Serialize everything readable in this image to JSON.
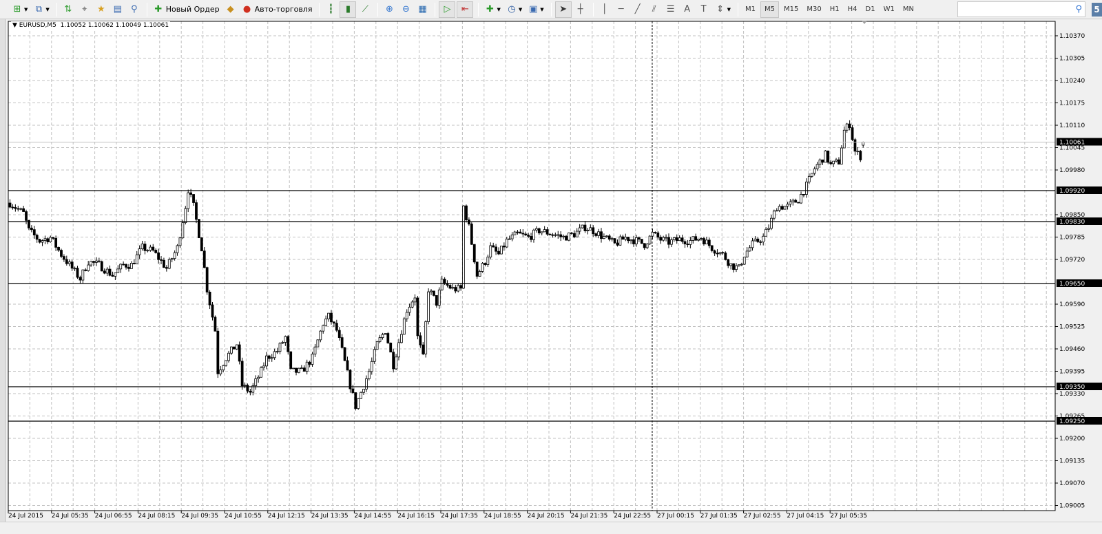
{
  "toolbar": {
    "items": [
      {
        "name": "new-chart",
        "icon": "new-chart-icon",
        "dropdown": true
      },
      {
        "name": "profiles",
        "icon": "profiles-icon",
        "dropdown": true
      },
      {
        "sep": true
      },
      {
        "name": "market-watch",
        "icon": "market-watch-icon"
      },
      {
        "name": "data-window",
        "icon": "crosshair-icon"
      },
      {
        "name": "navigator",
        "icon": "navigator-icon"
      },
      {
        "name": "terminal",
        "icon": "terminal-icon"
      },
      {
        "name": "strategy-tester",
        "icon": "tester-icon"
      },
      {
        "sep": true
      },
      {
        "name": "new-order",
        "icon": "new-order-icon",
        "label": "Новый Ордер"
      },
      {
        "name": "metaeditor",
        "icon": "metaeditor-icon"
      },
      {
        "name": "auto-trading",
        "icon": "auto-trading-icon",
        "label": "Авто-торговля"
      },
      {
        "sep": true
      },
      {
        "name": "bar-chart",
        "icon": "bar-chart-icon"
      },
      {
        "name": "candlesticks",
        "icon": "candlestick-icon",
        "active": true
      },
      {
        "name": "line-chart",
        "icon": "line-chart-icon"
      },
      {
        "sep": true
      },
      {
        "name": "zoom-in",
        "icon": "zoom-in-icon"
      },
      {
        "name": "zoom-out",
        "icon": "zoom-out-icon"
      },
      {
        "name": "tile-windows",
        "icon": "tile-icon"
      },
      {
        "sep": true
      },
      {
        "name": "auto-scroll",
        "icon": "auto-scroll-icon",
        "active": true
      },
      {
        "name": "chart-shift",
        "icon": "chart-shift-icon",
        "active": true
      },
      {
        "sep": true
      },
      {
        "name": "indicators",
        "icon": "indicators-icon",
        "dropdown": true
      },
      {
        "name": "periods",
        "icon": "clock-icon",
        "dropdown": true
      },
      {
        "name": "templates",
        "icon": "templates-icon",
        "dropdown": true
      },
      {
        "sep": true
      },
      {
        "name": "cursor",
        "icon": "cursor-icon",
        "active": true
      },
      {
        "name": "crosshair",
        "icon": "crosshair-tool-icon"
      },
      {
        "sep": true
      },
      {
        "name": "vertical-line",
        "icon": "vertical-line-icon"
      },
      {
        "name": "horizontal-line",
        "icon": "horizontal-line-icon"
      },
      {
        "name": "trendline",
        "icon": "trendline-icon"
      },
      {
        "name": "equidistant-channel",
        "icon": "channel-icon"
      },
      {
        "name": "fibonacci",
        "icon": "fibonacci-icon"
      },
      {
        "name": "text",
        "icon": "text-icon"
      },
      {
        "name": "text-label",
        "icon": "text-label-icon"
      },
      {
        "name": "arrows",
        "icon": "arrows-icon",
        "dropdown": true
      },
      {
        "sep": true
      }
    ],
    "timeframes": [
      "M1",
      "M5",
      "M15",
      "M30",
      "H1",
      "H4",
      "D1",
      "W1",
      "MN"
    ],
    "active_timeframe": "M5",
    "search_placeholder": "",
    "badge": "5"
  },
  "chart_data": {
    "type": "candlestick",
    "title": "EURUSD,M5  1.10052 1.10062 1.10049 1.10061",
    "symbol": "EURUSD",
    "timeframe": "M5",
    "ohlc_last": {
      "open": 1.10052,
      "high": 1.10062,
      "low": 1.10049,
      "close": 1.10061
    },
    "bid": "1.10061",
    "ylim": [
      1.09005,
      1.10405
    ],
    "y_ticks": [
      "1.10370",
      "1.10305",
      "1.10240",
      "1.10175",
      "1.10110",
      "1.10045",
      "1.09980",
      "1.09850",
      "1.09785",
      "1.09720",
      "1.09590",
      "1.09525",
      "1.09460",
      "1.09395",
      "1.09330",
      "1.09265",
      "1.09200",
      "1.09135",
      "1.09070",
      "1.09005"
    ],
    "x_ticks": [
      "24 Jul 2015",
      "24 Jul 05:35",
      "24 Jul 06:55",
      "24 Jul 08:15",
      "24 Jul 09:35",
      "24 Jul 10:55",
      "24 Jul 12:15",
      "24 Jul 13:35",
      "24 Jul 14:55",
      "24 Jul 16:15",
      "24 Jul 17:35",
      "24 Jul 18:55",
      "24 Jul 20:15",
      "24 Jul 21:35",
      "24 Jul 22:55",
      "27 Jul 00:15",
      "27 Jul 01:35",
      "27 Jul 02:55",
      "27 Jul 04:15",
      "27 Jul 05:35"
    ],
    "bars_per_x_tick": 16,
    "horizontal_lines": [
      "1.09920",
      "1.09830",
      "1.09650",
      "1.09350",
      "1.09250"
    ],
    "day_separator_bar": 238,
    "close_path": [
      [
        0,
        1.09884
      ],
      [
        5,
        1.09854
      ],
      [
        7,
        1.09804
      ],
      [
        11,
        1.09774
      ],
      [
        15,
        1.09784
      ],
      [
        19,
        1.09734
      ],
      [
        22,
        1.09704
      ],
      [
        26,
        1.09664
      ],
      [
        29,
        1.09714
      ],
      [
        33,
        1.09704
      ],
      [
        38,
        1.09674
      ],
      [
        42,
        1.09704
      ],
      [
        45,
        1.09704
      ],
      [
        49,
        1.09754
      ],
      [
        53,
        1.09744
      ],
      [
        58,
        1.09694
      ],
      [
        62,
        1.09754
      ],
      [
        65,
        1.09874
      ],
      [
        66,
        1.09924
      ],
      [
        68,
        1.09874
      ],
      [
        71,
        1.09754
      ],
      [
        73,
        1.09634
      ],
      [
        76,
        1.09514
      ],
      [
        77,
        1.09394
      ],
      [
        80,
        1.09434
      ],
      [
        84,
        1.09474
      ],
      [
        86,
        1.09354
      ],
      [
        89,
        1.09334
      ],
      [
        93,
        1.09394
      ],
      [
        95,
        1.09434
      ],
      [
        99,
        1.09454
      ],
      [
        102,
        1.09494
      ],
      [
        104,
        1.09394
      ],
      [
        108,
        1.09394
      ],
      [
        112,
        1.09434
      ],
      [
        116,
        1.09534
      ],
      [
        118,
        1.09554
      ],
      [
        121,
        1.09514
      ],
      [
        123,
        1.09454
      ],
      [
        126,
        1.09354
      ],
      [
        128,
        1.09294
      ],
      [
        131,
        1.09354
      ],
      [
        133,
        1.09394
      ],
      [
        136,
        1.09474
      ],
      [
        139,
        1.09514
      ],
      [
        142,
        1.09414
      ],
      [
        145,
        1.09514
      ],
      [
        147,
        1.09574
      ],
      [
        150,
        1.09614
      ],
      [
        151,
        1.09494
      ],
      [
        153,
        1.09434
      ],
      [
        155,
        1.09634
      ],
      [
        158,
        1.09594
      ],
      [
        160,
        1.09654
      ],
      [
        164,
        1.09634
      ],
      [
        167,
        1.09634
      ],
      [
        168,
        1.09874
      ],
      [
        170,
        1.09814
      ],
      [
        173,
        1.09674
      ],
      [
        176,
        1.09714
      ],
      [
        178,
        1.09754
      ],
      [
        181,
        1.09734
      ],
      [
        184,
        1.09774
      ],
      [
        188,
        1.09794
      ],
      [
        192,
        1.09784
      ],
      [
        196,
        1.09804
      ],
      [
        201,
        1.09794
      ],
      [
        205,
        1.09784
      ],
      [
        209,
        1.09794
      ],
      [
        213,
        1.09814
      ],
      [
        216,
        1.09804
      ],
      [
        220,
        1.09784
      ],
      [
        224,
        1.09764
      ],
      [
        228,
        1.09784
      ],
      [
        232,
        1.09774
      ],
      [
        235,
        1.09764
      ],
      [
        238,
        1.09794
      ],
      [
        241,
        1.09778
      ],
      [
        244,
        1.0977
      ],
      [
        248,
        1.09778
      ],
      [
        252,
        1.09774
      ],
      [
        256,
        1.09784
      ],
      [
        260,
        1.09754
      ],
      [
        264,
        1.09734
      ],
      [
        267,
        1.09704
      ],
      [
        270,
        1.09694
      ],
      [
        272,
        1.09734
      ],
      [
        275,
        1.09764
      ],
      [
        279,
        1.09784
      ],
      [
        281,
        1.09814
      ],
      [
        284,
        1.09874
      ],
      [
        288,
        1.09874
      ],
      [
        292,
        1.09894
      ],
      [
        295,
        1.09934
      ],
      [
        298,
        1.09984
      ],
      [
        302,
        1.10024
      ],
      [
        304,
        1.09994
      ],
      [
        307,
        1.10004
      ],
      [
        309,
        1.10094
      ],
      [
        311,
        1.10114
      ],
      [
        313,
        1.10034
      ],
      [
        315,
        1.1002
      ],
      [
        316,
        1.10061
      ]
    ]
  },
  "colors": {
    "grid": "#c0c0c0",
    "candle": "#000000",
    "bg": "#ffffff",
    "bid_line": "#c0c0c0"
  }
}
